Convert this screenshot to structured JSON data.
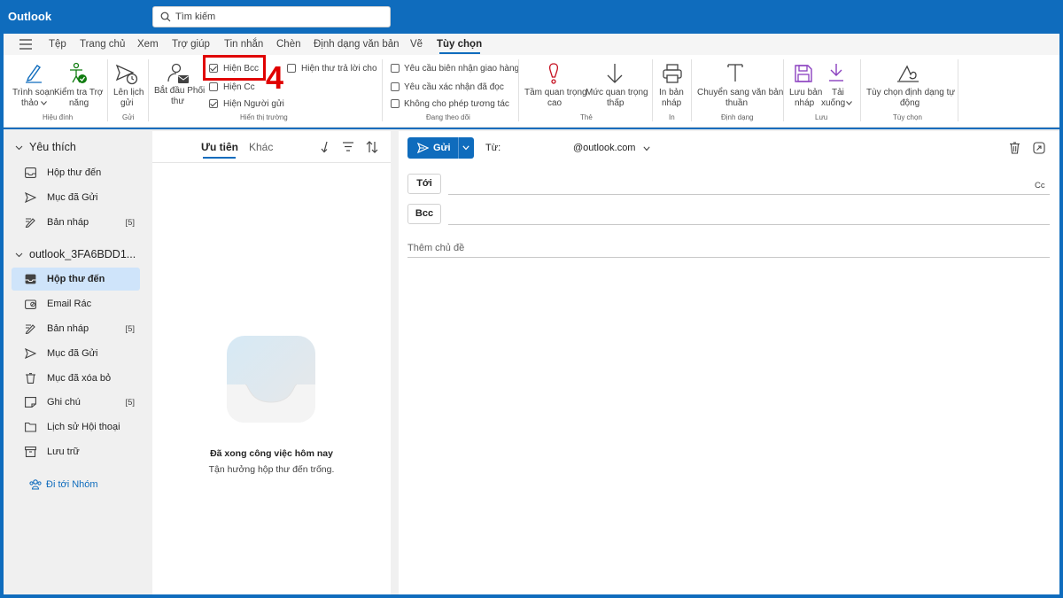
{
  "app": {
    "title": "Outlook"
  },
  "search": {
    "placeholder": "Tìm kiếm"
  },
  "menu_tabs": [
    "Tệp",
    "Trang chủ",
    "Xem",
    "Trợ giúp",
    "Tin nhắn",
    "Chèn",
    "Định dạng văn bản",
    "Vẽ",
    "Tùy chọn"
  ],
  "active_tab": "Tùy chọn",
  "ribbon": {
    "editor_line1": "Trình soạn",
    "editor_line2": "thảo",
    "accessibility_line1": "Kiểm tra Trợ",
    "accessibility_line2": "năng",
    "group_editing": "Hiệu đính",
    "schedule_line1": "Lên lịch",
    "schedule_line2": "gửi",
    "group_send": "Gửi",
    "coord_line1": "Bắt đầu Phối",
    "coord_line2": "thư",
    "show_bcc": "Hiện Bcc",
    "show_cc": "Hiện Cc",
    "show_from": "Hiện Người gửi",
    "show_reply": "Hiện thư trả lời cho",
    "group_fields": "Hiển thị trường",
    "req_delivery": "Yêu cầu biên nhận giao hàng",
    "req_read": "Yêu cầu xác nhận đã đọc",
    "no_react": "Không cho phép tương tác",
    "group_tracking": "Đang theo dõi",
    "high_line1": "Tầm quan trọng",
    "high_line2": "cao",
    "low_line1": "Mức quan trọng",
    "low_line2": "thấp",
    "group_tags": "Thẻ",
    "print_line1": "In bản",
    "print_line2": "nháp",
    "group_print": "In",
    "plain_line1": "Chuyển sang văn bản",
    "plain_line2": "thuần",
    "group_format": "Định dạng",
    "save_line1": "Lưu bản",
    "save_line2": "nháp",
    "download_line1": "Tải",
    "download_line2": "xuống",
    "group_save": "Lưu",
    "autoformat_line1": "Tùy chọn định dạng tự",
    "autoformat_line2": "động",
    "group_options": "Tùy chọn"
  },
  "checkbox_states": {
    "show_bcc": true,
    "show_cc": false,
    "show_from": true,
    "show_reply": false,
    "req_delivery": false,
    "req_read": false,
    "no_react": false
  },
  "annotation": {
    "step": "4"
  },
  "folders": {
    "favorites_header": "Yêu thích",
    "favorites": [
      {
        "label": "Hộp thư đến",
        "count": ""
      },
      {
        "label": "Mục đã Gửi",
        "count": ""
      },
      {
        "label": "Bản nháp",
        "count": "[5]"
      }
    ],
    "account_header": "outlook_3FA6BDD1...",
    "account": [
      {
        "label": "Hộp thư đến",
        "count": ""
      },
      {
        "label": "Email Rác",
        "count": ""
      },
      {
        "label": "Bản nháp",
        "count": "[5]"
      },
      {
        "label": "Mục đã Gửi",
        "count": ""
      },
      {
        "label": "Mục đã xóa bỏ",
        "count": ""
      },
      {
        "label": "Ghi chú",
        "count": "[5]"
      },
      {
        "label": "Lịch sử Hội thoại",
        "count": ""
      },
      {
        "label": "Lưu trữ",
        "count": ""
      }
    ],
    "groups_link": "Đi tới Nhóm"
  },
  "message_list": {
    "tab_focused": "Ưu tiên",
    "tab_other": "Khác",
    "empty_title": "Đã xong công việc hôm nay",
    "empty_subtitle": "Tận hưởng hộp thư đến trống."
  },
  "compose": {
    "send_label": "Gửi",
    "from_label": "Từ:",
    "from_address": "@outlook.com",
    "to_label": "Tới",
    "cc_label": "Cc",
    "bcc_label": "Bcc",
    "subject_placeholder": "Thêm chủ đề"
  },
  "colors": {
    "brand": "#0f6cbd",
    "highlight": "#e00000",
    "selected": "#cfe4fa"
  }
}
